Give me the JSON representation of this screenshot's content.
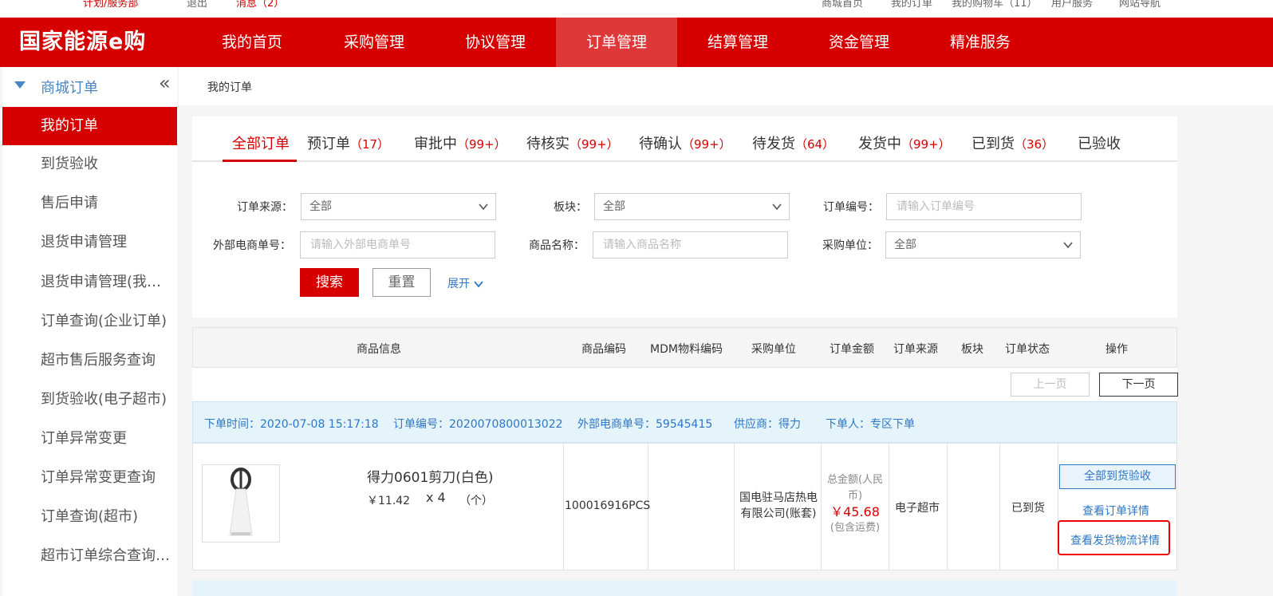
{
  "top_strip": {
    "left_items": [
      "",
      "计划/服务部",
      "退出",
      "消息（2）"
    ],
    "right_items": [
      "商城首页",
      "我的订单",
      "我的购物车（11）",
      "用户服务",
      "网站导航"
    ]
  },
  "header": {
    "logo": "国家能源e购",
    "nav": [
      "我的首页",
      "采购管理",
      "协议管理",
      "订单管理",
      "结算管理",
      "资金管理",
      "精准服务"
    ],
    "active_nav": "订单管理"
  },
  "sidebar": {
    "title": "商城订单",
    "collapse_icon": "«",
    "items": [
      "我的订单",
      "到货验收",
      "售后申请",
      "退货申请管理",
      "退货申请管理(我的…",
      "订单查询(企业订单)",
      "超市售后服务查询",
      "到货验收(电子超市)",
      "订单异常变更",
      "订单异常变更查询",
      "订单查询(超市)",
      "超市订单综合查询(…"
    ]
  },
  "breadcrumb": "我的订单",
  "tabs": [
    {
      "label": "全部订单",
      "count": ""
    },
    {
      "label": "预订单",
      "count": "（17）"
    },
    {
      "label": "审批中",
      "count": "（99+）"
    },
    {
      "label": "待核实",
      "count": "（99+）"
    },
    {
      "label": "待确认",
      "count": "（99+）"
    },
    {
      "label": "待发货",
      "count": "（64）"
    },
    {
      "label": "发货中",
      "count": "（99+）"
    },
    {
      "label": "已到货",
      "count": "（36）"
    },
    {
      "label": "已验收",
      "count": ""
    }
  ],
  "filters": {
    "order_source": {
      "label": "订单来源：",
      "value": "全部"
    },
    "segment": {
      "label": "板块：",
      "value": "全部"
    },
    "order_no": {
      "label": "订单编号：",
      "placeholder": "请输入订单编号"
    },
    "external_no": {
      "label": "外部电商单号：",
      "placeholder": "请输入外部电商单号"
    },
    "product_name": {
      "label": "商品名称：",
      "placeholder": "请输入商品名称"
    },
    "buyer_unit": {
      "label": "采购单位：",
      "value": "全部"
    },
    "search_label": "搜索",
    "reset_label": "重置",
    "expand_label": "展开"
  },
  "table_headers": [
    "商品信息",
    "商品编码",
    "MDM物料编码",
    "采购单位",
    "订单金额",
    "订单来源",
    "板块",
    "订单状态",
    "操作"
  ],
  "pager": {
    "prev": "上一页",
    "next": "下一页"
  },
  "order": {
    "time_label": "下单时间：",
    "time": "2020-07-08 15:17:18",
    "no_label": "订单编号：",
    "no": "2020070800013022",
    "ext_label": "外部电商单号：",
    "ext": "59545415",
    "supplier_label": "供应商：",
    "supplier": "得力",
    "placer_label": "下单人：",
    "placer": "专区下单",
    "product_name": "得力0601剪刀(白色)",
    "price": "￥11.42",
    "qty": "x 4",
    "unit": "（个）",
    "code": "100016916PCS",
    "mdm": "",
    "buyer": "国电驻马店热电有限公司(账套)",
    "total_label": "总金额(人民币)",
    "total": "￥45.68",
    "freight_note": "(包含运费)",
    "source": "电子超市",
    "segment": "",
    "status": "已到货",
    "actions": {
      "accept_all": "全部到货验收",
      "view_detail": "查看订单详情",
      "view_logistics": "查看发货物流详情"
    }
  }
}
